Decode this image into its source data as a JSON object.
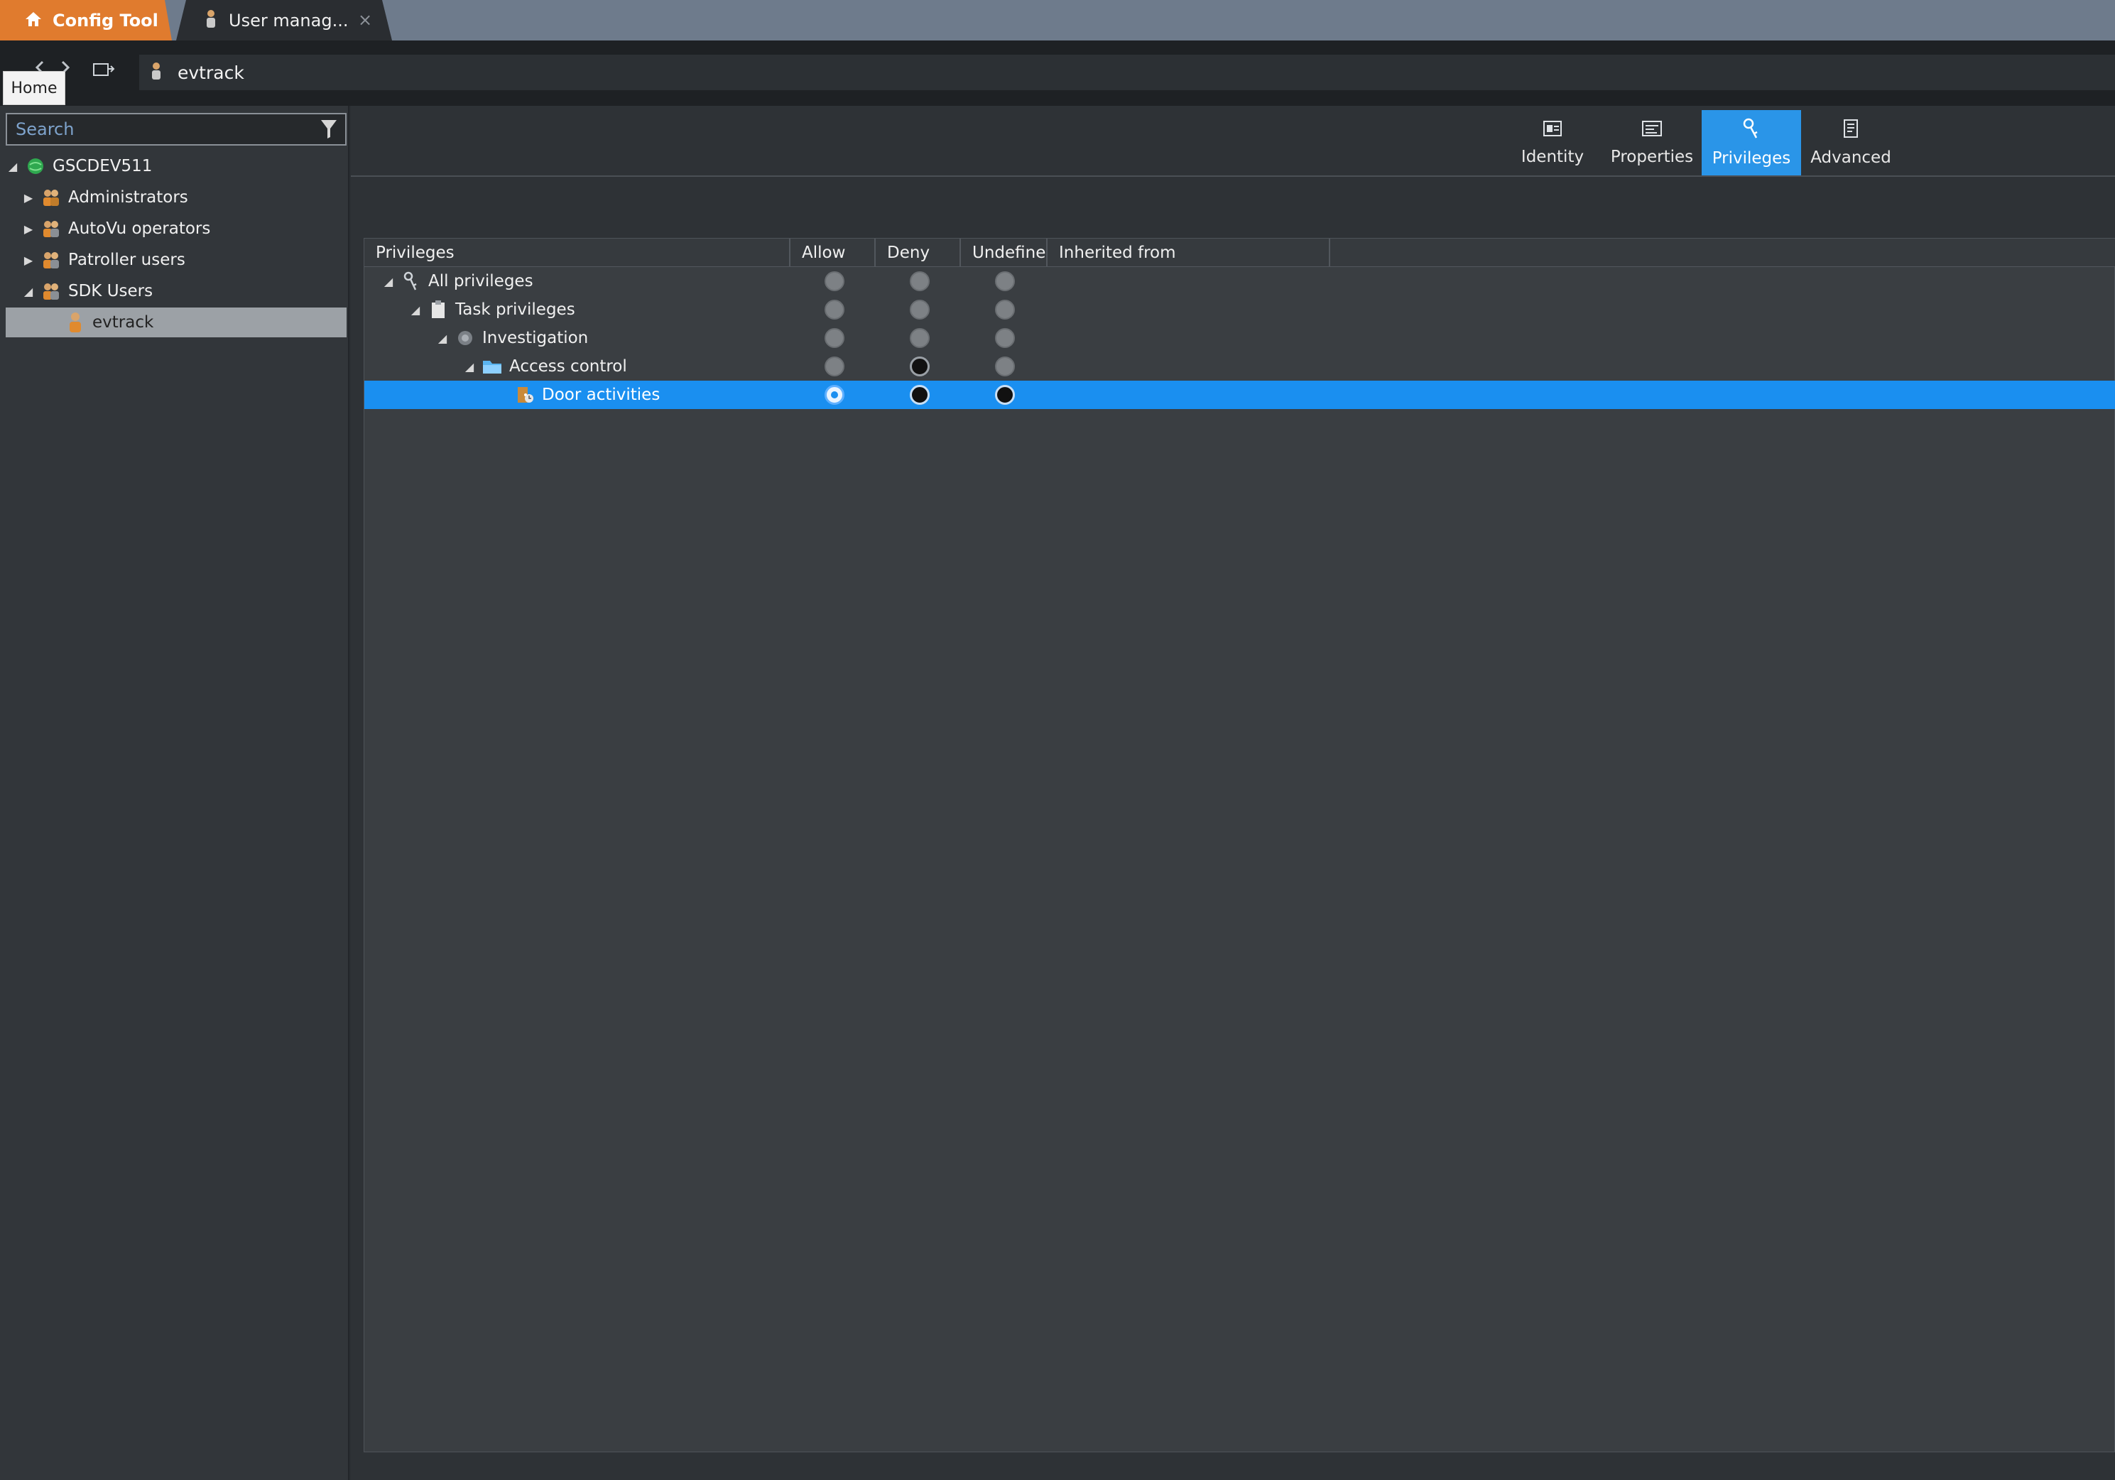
{
  "tabs": {
    "config_tool": "Config Tool",
    "user_management": "User manag...",
    "close_glyph": "×"
  },
  "address": {
    "path_item": "evtrack",
    "tooltip": "Home"
  },
  "search": {
    "placeholder": "Search"
  },
  "tree": {
    "root": "GSCDEV511",
    "items": [
      "Administrators",
      "AutoVu operators",
      "Patroller users",
      "SDK Users"
    ],
    "selected_child": "evtrack"
  },
  "view_tabs": {
    "identity": "Identity",
    "properties": "Properties",
    "privileges": "Privileges",
    "advanced": "Advanced",
    "active": "Privileges"
  },
  "grid": {
    "columns": [
      "Privileges",
      "Allow",
      "Deny",
      "Undefine",
      "Inherited from"
    ],
    "rows": [
      {
        "label": "All privileges",
        "allow": "none",
        "deny": "none",
        "undefine": "none"
      },
      {
        "label": "Task privileges",
        "allow": "none",
        "deny": "none",
        "undefine": "none"
      },
      {
        "label": "Investigation",
        "allow": "none",
        "deny": "none",
        "undefine": "none"
      },
      {
        "label": "Access control",
        "allow": "none",
        "deny": "set",
        "undefine": "none"
      },
      {
        "label": "Door activities",
        "allow": "selected",
        "deny": "set",
        "undefine": "set"
      }
    ]
  },
  "colors": {
    "accent": "#1a8ff0",
    "config_tab": "#e07b2e",
    "tabstrip": "#6e7b8c"
  }
}
